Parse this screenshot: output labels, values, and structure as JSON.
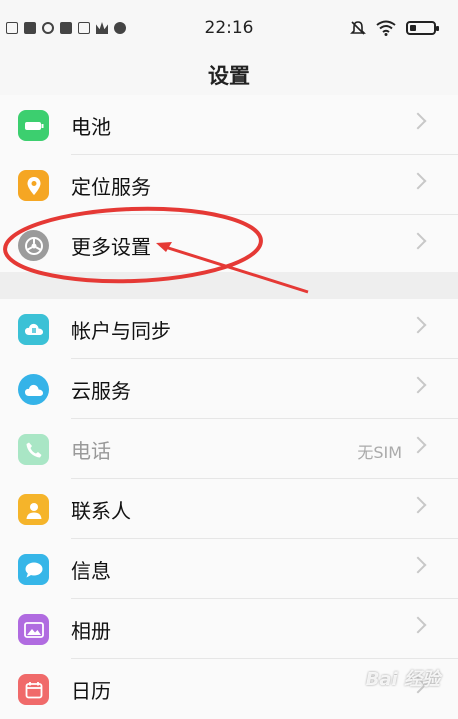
{
  "status": {
    "time": "22:16",
    "battery_level": 0.25
  },
  "header": {
    "title": "设置"
  },
  "settings": {
    "group1": [
      {
        "label": "电池",
        "icon": "battery-icon",
        "color": "#3ccf6f"
      },
      {
        "label": "定位服务",
        "icon": "location-icon",
        "color": "#f5a623"
      },
      {
        "label": "更多设置",
        "icon": "gear-icon",
        "color": "#9b9b9b"
      }
    ],
    "group2": [
      {
        "label": "帐户与同步",
        "icon": "sync-icon",
        "color": "#3bc1d6"
      },
      {
        "label": "云服务",
        "icon": "cloud-icon",
        "color": "#35b3e8"
      },
      {
        "label": "电话",
        "icon": "phone-icon",
        "color": "#a9e6c5",
        "value": "无SIM",
        "disabled": true
      },
      {
        "label": "联系人",
        "icon": "contacts-icon",
        "color": "#f5b42a"
      },
      {
        "label": "信息",
        "icon": "message-icon",
        "color": "#36b6e8"
      },
      {
        "label": "相册",
        "icon": "album-icon",
        "color": "#b06be0"
      },
      {
        "label": "日历",
        "icon": "calendar-icon",
        "color": "#f06a6a"
      }
    ]
  },
  "annotation": {
    "color": "#e53935"
  },
  "watermark": {
    "text": "Bai 经验"
  }
}
